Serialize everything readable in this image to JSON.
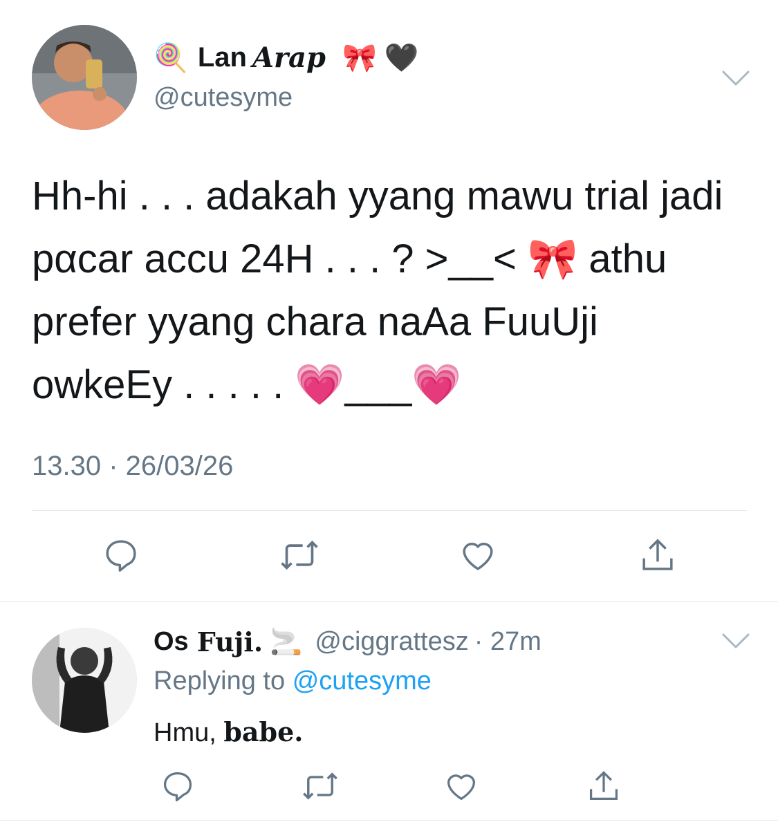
{
  "tweet": {
    "display_name_prefix_emoji": "🍭",
    "display_name_first": "Lan",
    "display_name_script": "Arap",
    "display_name_suffix_emoji": "🎀 🖤",
    "handle": "@cutesyme",
    "text_line1": "Hh-hi . . . adakah yyang mawu trial jadi",
    "text_line2": "pαcar accu 24H . . . ? >__< 🎀 athu",
    "text_line3": "prefer yyang chara naAa FuuUji",
    "text_line4": "owkeEy . . . . . 💗___💗",
    "timestamp": "13.30 · 26/03/26"
  },
  "reply": {
    "name_first": "Os",
    "name_blackletter": "Fuji.",
    "name_emoji": "🚬",
    "handle": "@ciggrattesz",
    "time": "· 27m",
    "replying_prefix": "Replying to",
    "replying_handle": "@cutesyme",
    "text_plain": "Hmu,",
    "text_blackletter": "babe."
  },
  "icons": {
    "reply": "reply-icon",
    "retweet": "retweet-icon",
    "like": "heart-icon",
    "share": "share-icon",
    "more": "chevron-down-icon"
  },
  "colors": {
    "muted": "#657786",
    "link": "#1da1f2",
    "divider": "#e1e8ed"
  }
}
